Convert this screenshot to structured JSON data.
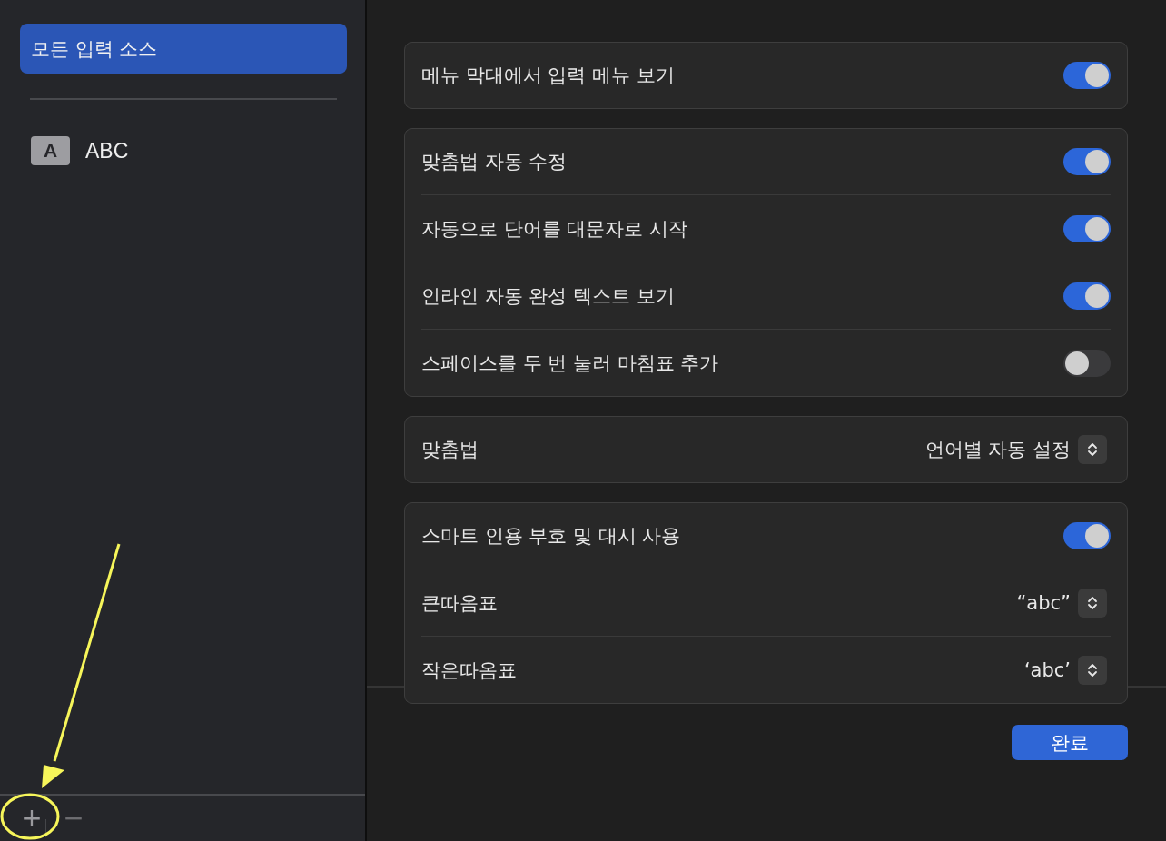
{
  "sidebar": {
    "items": [
      {
        "kind": "all",
        "label": "모든 입력 소스",
        "selected": true
      },
      {
        "kind": "source",
        "badge": "A",
        "label": "ABC",
        "selected": false
      }
    ],
    "add_button": "+",
    "remove_button": "−"
  },
  "groups": [
    {
      "rows": [
        {
          "kind": "toggle",
          "label": "메뉴 막대에서 입력 메뉴 보기",
          "on": true
        }
      ]
    },
    {
      "rows": [
        {
          "kind": "toggle",
          "label": "맞춤법 자동 수정",
          "on": true
        },
        {
          "kind": "toggle",
          "label": "자동으로 단어를 대문자로 시작",
          "on": true
        },
        {
          "kind": "toggle",
          "label": "인라인 자동 완성 텍스트 보기",
          "on": true
        },
        {
          "kind": "toggle",
          "label": "스페이스를 두 번 눌러 마침표 추가",
          "on": false
        }
      ]
    },
    {
      "rows": [
        {
          "kind": "popup",
          "label": "맞춤법",
          "value": "언어별 자동 설정"
        }
      ]
    },
    {
      "rows": [
        {
          "kind": "toggle",
          "label": "스마트 인용 부호 및 대시 사용",
          "on": true
        },
        {
          "kind": "popup",
          "label": "큰따옴표",
          "value": "“abc”"
        },
        {
          "kind": "popup",
          "label": "작은따옴표",
          "value": "‘abc’"
        }
      ]
    }
  ],
  "done_button": "완료"
}
